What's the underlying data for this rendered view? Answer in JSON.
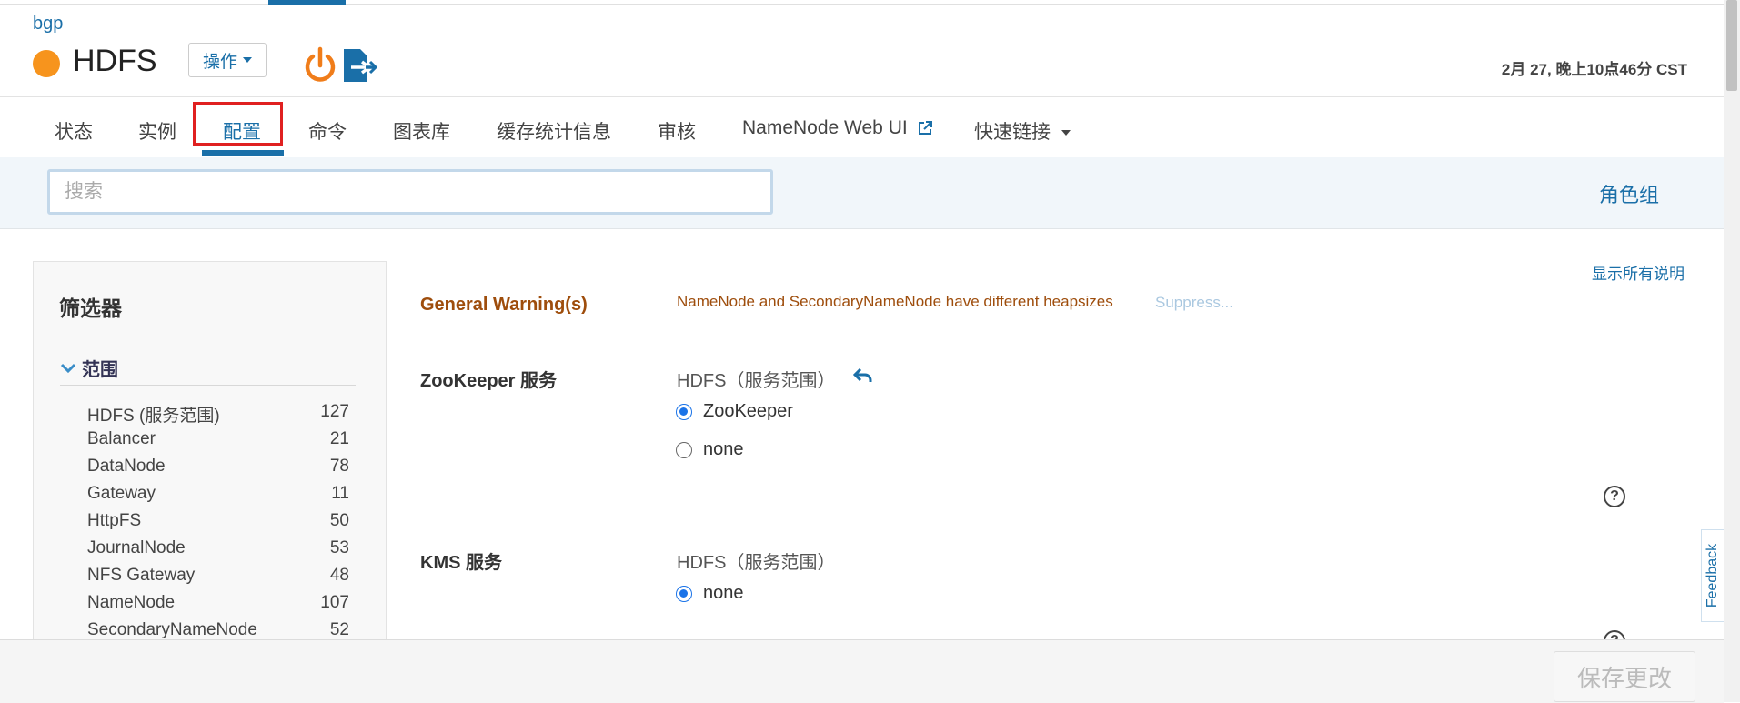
{
  "header": {
    "cluster_link": "bgp",
    "service_name": "HDFS",
    "status_color": "#f7941d",
    "actions_label": "操作",
    "datetime": "2月 27, 晚上10点46分 CST",
    "icons": [
      "power-icon",
      "export-icon"
    ]
  },
  "tabs": [
    {
      "label": "状态"
    },
    {
      "label": "实例"
    },
    {
      "label": "配置",
      "active": true
    },
    {
      "label": "命令"
    },
    {
      "label": "图表库"
    },
    {
      "label": "缓存统计信息"
    },
    {
      "label": "审核"
    },
    {
      "label": "NameNode Web UI",
      "icon": "external-link-icon"
    },
    {
      "label": "快速链接",
      "icon": "caret-down-icon"
    }
  ],
  "search": {
    "placeholder": "搜索",
    "value": "",
    "role_groups_link": "角色组"
  },
  "filters": {
    "title": "筛选器",
    "scope_label": "范围",
    "items": [
      {
        "label": "HDFS (服务范围)",
        "count": "127"
      },
      {
        "label": "Balancer",
        "count": "21"
      },
      {
        "label": "DataNode",
        "count": "78"
      },
      {
        "label": "Gateway",
        "count": "11"
      },
      {
        "label": "HttpFS",
        "count": "50"
      },
      {
        "label": "JournalNode",
        "count": "53"
      },
      {
        "label": "NFS Gateway",
        "count": "48"
      },
      {
        "label": "NameNode",
        "count": "107"
      },
      {
        "label": "SecondaryNameNode",
        "count": "52"
      }
    ]
  },
  "main": {
    "show_all_descriptions": "显示所有说明",
    "warning": {
      "label": "General Warning(s)",
      "text": "NameNode and SecondaryNameNode have different heapsizes",
      "suppress": "Suppress...",
      "color": "#9e4d0c"
    },
    "zookeeper": {
      "label": "ZooKeeper 服务",
      "scope": "HDFS（服务范围）",
      "options": [
        {
          "label": "ZooKeeper",
          "selected": true
        },
        {
          "label": "none",
          "selected": false
        }
      ]
    },
    "kms": {
      "label": "KMS 服务",
      "scope": "HDFS（服务范围）",
      "options": [
        {
          "label": "none",
          "selected": true
        }
      ]
    }
  },
  "feedback_label": "Feedback",
  "save_label": "保存更改",
  "accent_color": "#1a6fa8"
}
